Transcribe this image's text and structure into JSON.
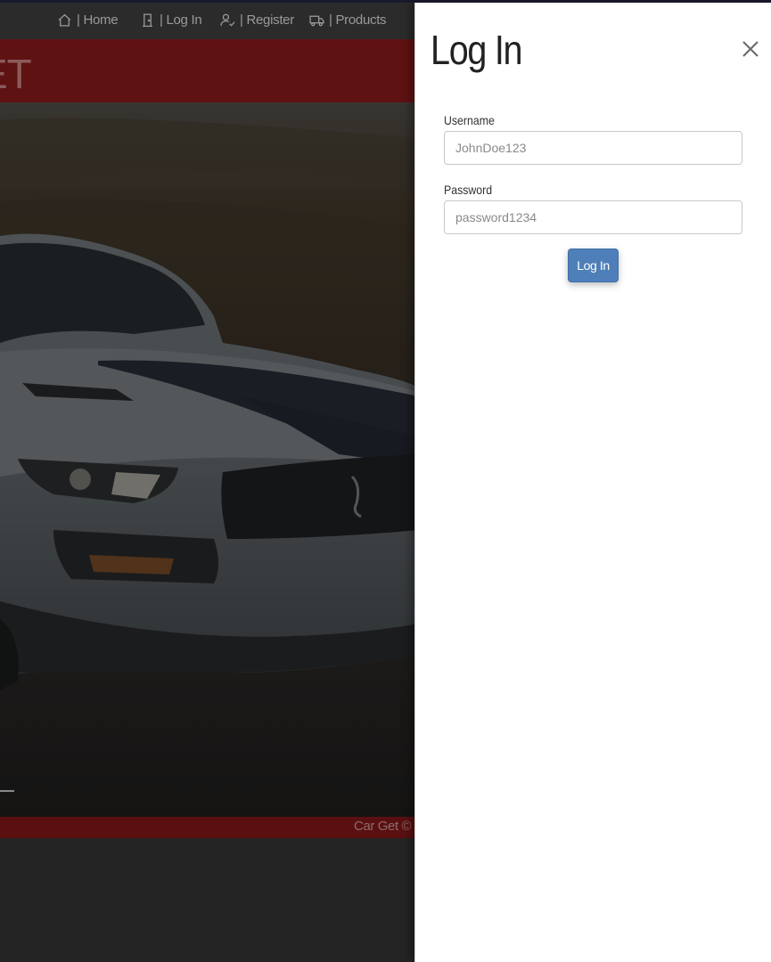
{
  "nav": {
    "items": [
      {
        "icon": "home-icon",
        "label": "| Home"
      },
      {
        "icon": "door-icon",
        "label": "| Log In"
      },
      {
        "icon": "user-check-icon",
        "label": "| Register"
      },
      {
        "icon": "truck-icon",
        "label": "| Products"
      }
    ]
  },
  "brand": {
    "text": "ET"
  },
  "footer": {
    "text": "Car Get © Co"
  },
  "modal": {
    "title": "Log In",
    "username_label": "Username",
    "username_placeholder": "JohnDoe123",
    "password_label": "Password",
    "password_placeholder": "password1234",
    "submit_label": "Log In"
  },
  "colors": {
    "nav_bg": "#2b2b2b",
    "brand_red": "#5e1212",
    "button_blue": "#4f7fb8",
    "drawer_bg": "#ffffff"
  }
}
